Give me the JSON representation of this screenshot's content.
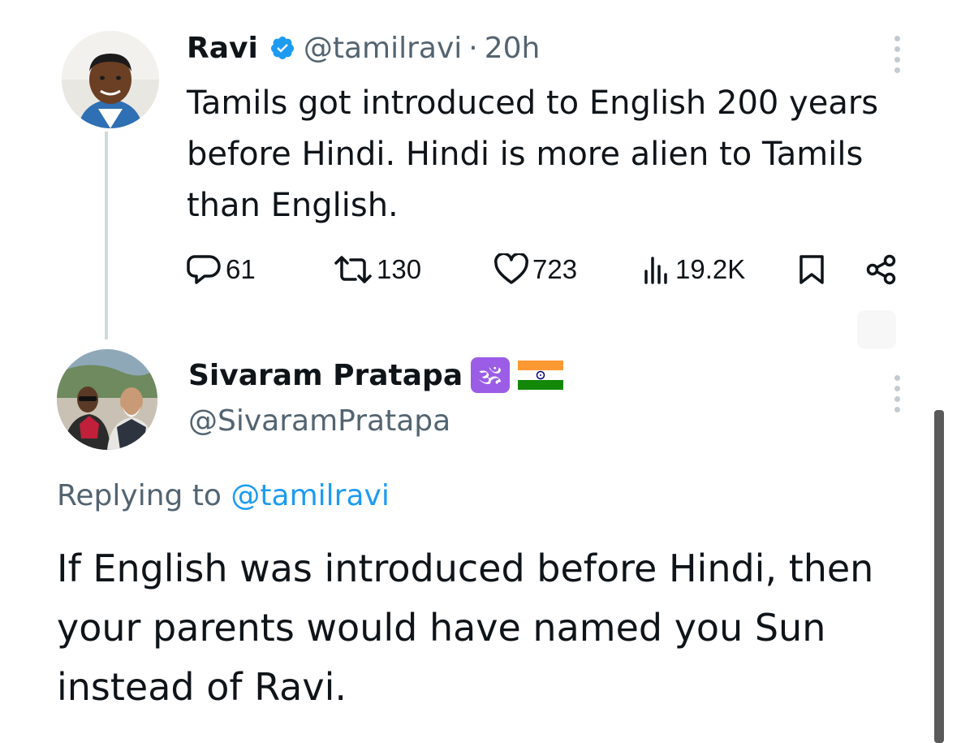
{
  "tweet": {
    "author_name": "Ravi",
    "author_handle": "@tamilravi",
    "separator": "·",
    "time": "20h",
    "text": "Tamils got introduced to English 200 years before Hindi. Hindi is more alien to Tamils than English.",
    "stats": {
      "replies": "61",
      "retweets": "130",
      "likes": "723",
      "views": "19.2K"
    },
    "icons": {
      "reply": "reply-icon",
      "retweet": "retweet-icon",
      "like": "heart-icon",
      "views": "views-icon",
      "bookmark": "bookmark-icon",
      "share": "share-icon",
      "verified": "verified-badge-icon",
      "more": "more-vertical-icon"
    }
  },
  "reply": {
    "author_name": "Sivaram Pratapa",
    "name_emoji": "🕉",
    "author_handle": "@SivaramPratapa",
    "replying_prefix": "Replying to",
    "replying_handle": "@tamilravi",
    "text": "If English was introduced before Hindi, then your parents would have named you Sun instead of Ravi."
  },
  "colors": {
    "text_primary": "#0f1419",
    "text_secondary": "#536471",
    "accent_blue": "#1d9bf0",
    "om_badge": "#9b5de5",
    "thread_line": "#cfd9de"
  }
}
